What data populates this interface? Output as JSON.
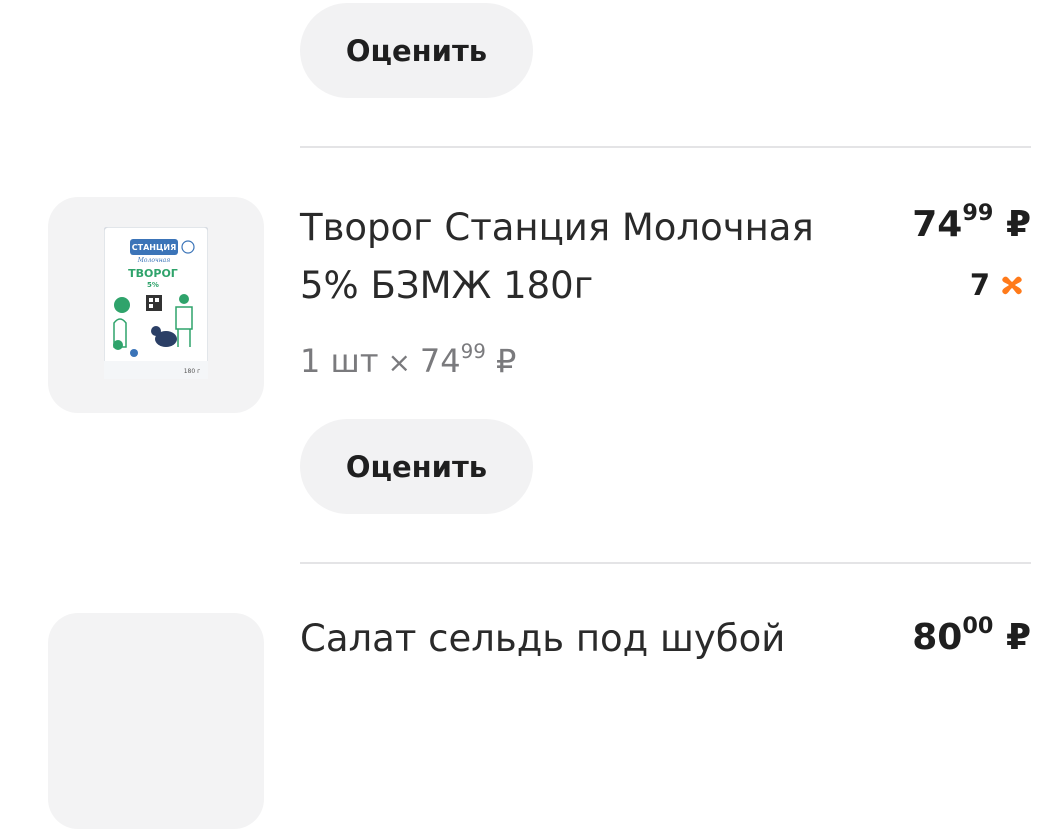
{
  "actions": {
    "rate_label": "Оценить"
  },
  "items": [
    {
      "name_line1": "Творог Станция Молочная",
      "name_line2": "5% БЗМЖ 180г",
      "price_int": "74",
      "price_frac": "99",
      "currency": "₽",
      "quantity": "7",
      "unit_count": "1 шт",
      "multiply": "×",
      "unit_price_int": "74",
      "unit_price_frac": "99",
      "pack": {
        "brand_top": "СТАНЦИЯ",
        "brand_bottom": "Молочная",
        "product": "ТВОРОГ",
        "fat": "5%",
        "weight": "180 г"
      }
    },
    {
      "name_line1": "Салат сельдь под шубой",
      "price_int": "80",
      "price_frac": "00",
      "currency": "₽"
    }
  ],
  "colors": {
    "accent": "#ff7a1a",
    "button_bg": "#f2f2f3",
    "thumb_bg": "#f3f3f4",
    "pack_green": "#2fa36b",
    "pack_blue": "#3b74b8"
  }
}
